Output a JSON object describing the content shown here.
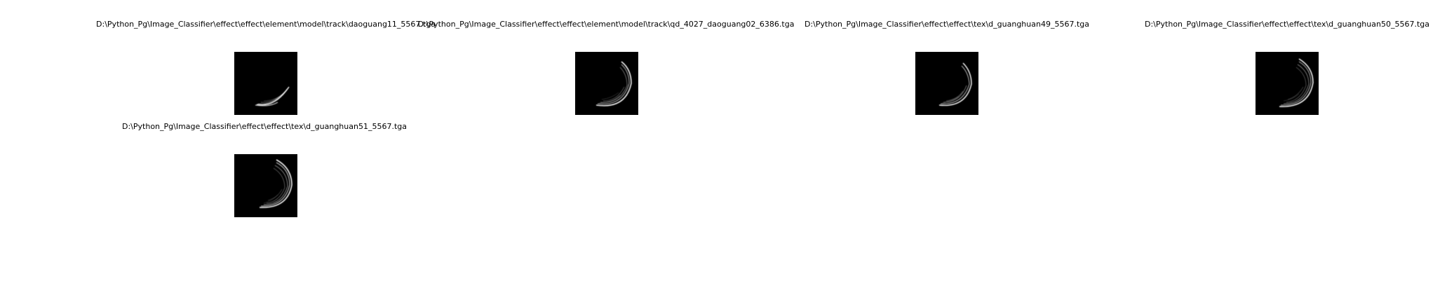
{
  "panels": [
    {
      "title": "D:\\Python_Pg\\Image_Classifier\\effect\\effect\\element\\model\\track\\daoguang11_5567.tga",
      "thumbnail": "crescent-glow-image"
    },
    {
      "title": "D:\\Python_Pg\\Image_Classifier\\effect\\effect\\element\\model\\track\\qd_4027_daoguang02_6386.tga",
      "thumbnail": "crescent-glow-image"
    },
    {
      "title": "D:\\Python_Pg\\Image_Classifier\\effect\\effect\\tex\\d_guanghuan49_5567.tga",
      "thumbnail": "crescent-glow-image"
    },
    {
      "title": "D:\\Python_Pg\\Image_Classifier\\effect\\effect\\tex\\d_guanghuan50_5567.tga",
      "thumbnail": "crescent-glow-image"
    },
    {
      "title": "D:\\Python_Pg\\Image_Classifier\\effect\\effect\\tex\\d_guanghuan51_5567.tga",
      "thumbnail": "crescent-glow-image"
    }
  ],
  "colors": {
    "background": "#ffffff",
    "thumbnail_background": "#000000",
    "glow": "#ffffff"
  }
}
